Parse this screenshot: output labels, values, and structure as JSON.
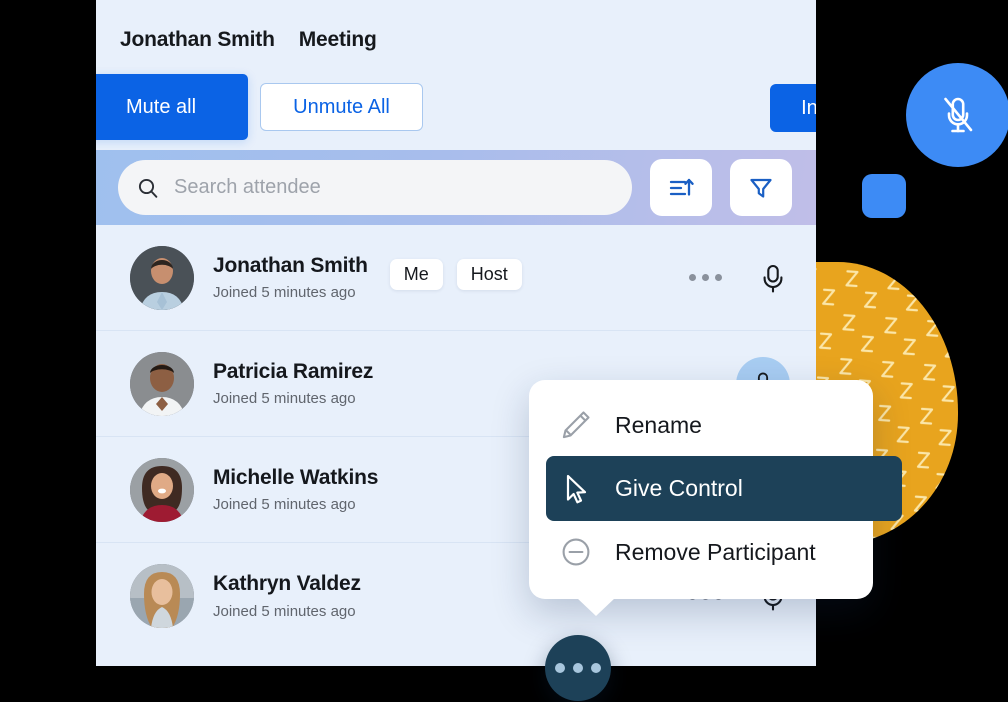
{
  "header": {
    "user_name": "Jonathan Smith",
    "meeting_label": "Meeting",
    "mute_all_label": "Mute all",
    "unmute_all_label": "Unmute All",
    "invite_label": "Invite"
  },
  "toolbar": {
    "search_placeholder": "Search attendee",
    "search_value": "",
    "search_icon": "search-icon",
    "sort_icon": "sort-ascending-icon",
    "filter_icon": "filter-funnel-icon"
  },
  "participants": [
    {
      "name": "Jonathan Smith",
      "joined": "Joined 5 minutes ago",
      "badges": [
        "Me",
        "Host"
      ],
      "mic_state": "mic-outline-icon"
    },
    {
      "name": "Patricia Ramirez",
      "joined": "Joined 5 minutes ago",
      "badges": [],
      "mic_state": "mic-round-button"
    },
    {
      "name": "Michelle Watkins",
      "joined": "Joined 5 minutes ago",
      "badges": [],
      "mic_state": "mic-outline-icon"
    },
    {
      "name": "Kathryn Valdez",
      "joined": "Joined 5 minutes ago",
      "badges": [],
      "mic_state": "mic-outline-icon"
    }
  ],
  "context_menu": {
    "items": [
      {
        "label": "Rename",
        "icon": "pencil-icon",
        "active": false
      },
      {
        "label": "Give Control",
        "icon": "cursor-arrow-icon",
        "active": true
      },
      {
        "label": "Remove Participant",
        "icon": "minus-circle-icon",
        "active": false
      }
    ]
  },
  "fab": {
    "icon": "more-horizontal-icon"
  },
  "decorations": {
    "mute_badge_icon": "mic-muted-icon",
    "square_shape": "blue-rounded-square",
    "blob_shape": "yellow-zigzag-blob"
  },
  "colors": {
    "primary_blue": "#0b63e5",
    "accent_blue": "#3d8bf5",
    "panel_bg": "#e8f0fb",
    "menu_active": "#1d4158",
    "blob_yellow": "#e8a41e"
  }
}
